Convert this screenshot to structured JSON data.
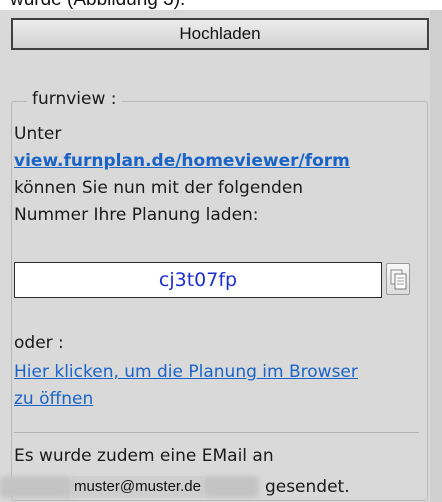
{
  "top_fragment": "wurde (Abbildung 3).",
  "upload_button": {
    "label": "Hochladen"
  },
  "furnview": {
    "legend": "furnview :",
    "line1": "Unter",
    "link": "view.furnplan.de/homeviewer/form",
    "line2": "können Sie nun mit der folgenden",
    "line3": "Nummer Ihre Planung laden:",
    "code": "cj3t07fp",
    "copy_icon": "copy-clipboard-icon",
    "oder": "oder :",
    "browser_link_line1": "Hier klicken, um die Planung im Browser",
    "browser_link_line2": "zu öffnen",
    "email_line1": "Es wurde zudem eine EMail an",
    "email_address": "muster@muster.de",
    "email_suffix": "gesendet."
  },
  "colors": {
    "panel_bg": "#d9d9d9",
    "link": "#1a64c8",
    "code_text": "#1c2fd6"
  }
}
